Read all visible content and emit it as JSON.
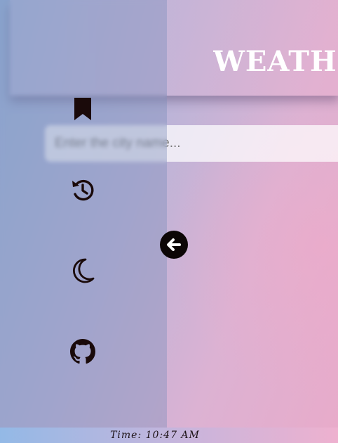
{
  "app": {
    "title": "WEATHER"
  },
  "search": {
    "placeholder": "Enter the city name...",
    "value": ""
  },
  "sidebar": {
    "items": [
      {
        "icon": "bookmark-icon"
      },
      {
        "icon": "history-icon"
      },
      {
        "icon": "moon-icon"
      },
      {
        "icon": "github-icon"
      }
    ],
    "collapse_icon": "arrow-left-circle-icon"
  },
  "footer": {
    "time_text": "Time: 10:47 AM"
  },
  "colors": {
    "icon": "#1a0a0a",
    "title": "#ffffff",
    "gradient_blue": "#8fb4dd",
    "gradient_pink": "#eaa8c8"
  }
}
